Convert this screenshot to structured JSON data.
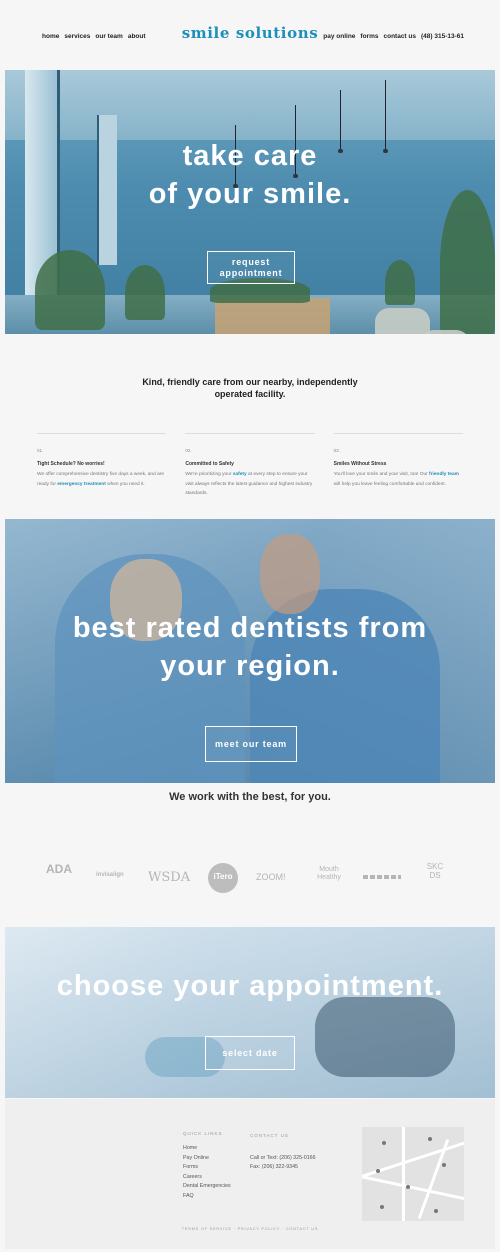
{
  "header": {
    "nav_left": [
      "home",
      "services",
      "our team",
      "about"
    ],
    "logo": "smile solutions",
    "nav_right": [
      "pay online",
      "forms",
      "contact us",
      "(48) 315-13-61"
    ]
  },
  "hero": {
    "title_line1": "take care",
    "title_line2": "of your smile.",
    "button_line1": "request",
    "button_line2": "appointment"
  },
  "intro": {
    "line1": "Kind, friendly care from our nearby, independently",
    "line2": "operated facility."
  },
  "features": [
    {
      "num": "01.",
      "title": "Tight Schedule? No worries!",
      "body_pre": "We offer comprehensive dentistry five days a week, and are ready for ",
      "highlight": "emergency treatment",
      "body_post": " when you need it."
    },
    {
      "num": "02.",
      "title": "Committed to Safety",
      "body_pre": "We're prioritizing your ",
      "highlight": "safety",
      "body_post": " at every step to ensure your visit always reflects the latest guidance and highest industry standards."
    },
    {
      "num": "03.",
      "title": "Smiles Without Stress",
      "body_pre": "You'll love your smile and your visit, too! Our ",
      "highlight": "friendly team",
      "body_post": " will help you leave feeling comfortable and confident."
    }
  ],
  "team": {
    "title_line1": "best rated dentists from",
    "title_line2": "your region.",
    "button": "meet our team"
  },
  "partners": {
    "title": "We work with the best, for you.",
    "logos": [
      "ADA",
      "invisalign",
      "WSDA",
      "iTero",
      "ZOOM!",
      "Mouth Healthy",
      "SKC DS"
    ]
  },
  "appointment": {
    "title": "choose your appointment.",
    "button": "select date"
  },
  "footer": {
    "quick_links_heading": "QUICK LINKS",
    "quick_links": [
      "Home",
      "Pay Online",
      "Forms",
      "Careers",
      "Dental Emergencies",
      "FAQ"
    ],
    "contact_heading": "CONTACT US",
    "phone": "Call or Text: (206) 325-0166",
    "fax": "Fax: (206) 322-9345",
    "legal": "TERMS OF SERVICE · PRIVACY POLICY · CONTACT US"
  }
}
